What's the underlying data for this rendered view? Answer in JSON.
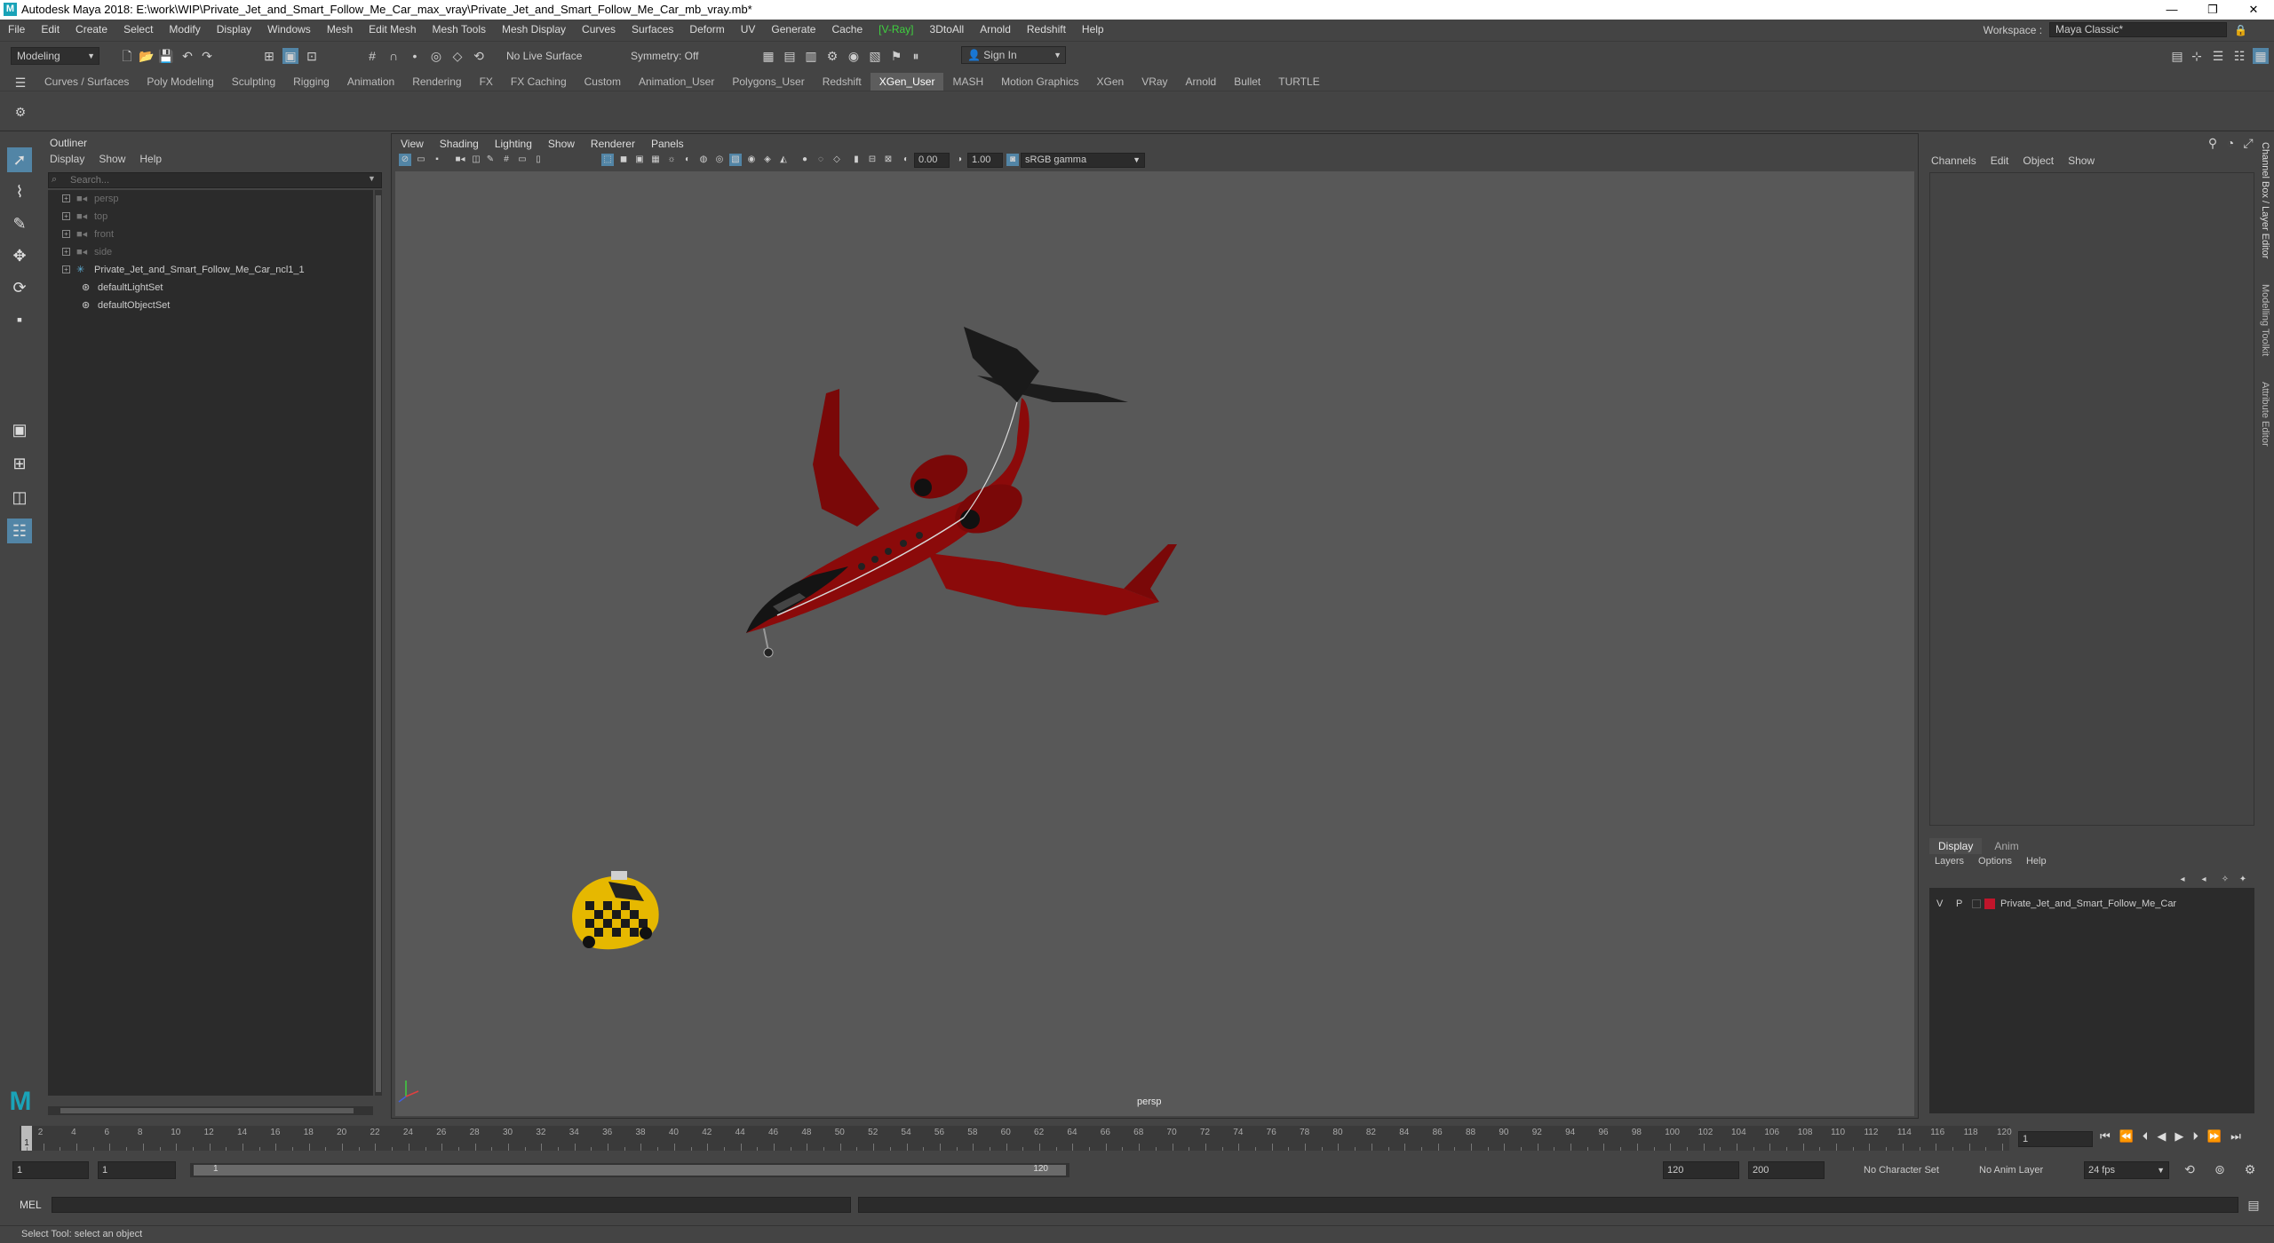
{
  "window": {
    "title": "Autodesk Maya 2018: E:\\work\\WIP\\Private_Jet_and_Smart_Follow_Me_Car_max_vray\\Private_Jet_and_Smart_Follow_Me_Car_mb_vray.mb*",
    "app_icon": "M",
    "minimize": "—",
    "maximize": "❐",
    "close": "✕"
  },
  "menubar": {
    "items": [
      "File",
      "Edit",
      "Create",
      "Select",
      "Modify",
      "Display",
      "Windows",
      "Mesh",
      "Edit Mesh",
      "Mesh Tools",
      "Mesh Display",
      "Curves",
      "Surfaces",
      "Deform",
      "UV",
      "Generate",
      "Cache",
      "[V-Ray]",
      "3DtoAll",
      "Arnold",
      "Redshift",
      "Help"
    ],
    "workspace_label": "Workspace :",
    "workspace_value": "Maya Classic*"
  },
  "statusline": {
    "menuset": "Modeling",
    "live_surface": "No Live Surface",
    "symmetry": "Symmetry: Off",
    "sign_in": "Sign In"
  },
  "shelf": {
    "tabs": [
      "Curves / Surfaces",
      "Poly Modeling",
      "Sculpting",
      "Rigging",
      "Animation",
      "Rendering",
      "FX",
      "FX Caching",
      "Custom",
      "Animation_User",
      "Polygons_User",
      "Redshift",
      "XGen_User",
      "MASH",
      "Motion Graphics",
      "XGen",
      "VRay",
      "Arnold",
      "Bullet",
      "TURTLE"
    ],
    "active_tab": "XGen_User"
  },
  "outliner": {
    "title": "Outliner",
    "menu": [
      "Display",
      "Show",
      "Help"
    ],
    "search_placeholder": "Search...",
    "items": [
      {
        "label": "persp",
        "dim": true,
        "icon": "camera-icon"
      },
      {
        "label": "top",
        "dim": true,
        "icon": "camera-icon"
      },
      {
        "label": "front",
        "dim": true,
        "icon": "camera-icon"
      },
      {
        "label": "side",
        "dim": true,
        "icon": "camera-icon"
      },
      {
        "label": "Private_Jet_and_Smart_Follow_Me_Car_ncl1_1",
        "dim": false,
        "icon": "group-icon"
      },
      {
        "label": "defaultLightSet",
        "dim": false,
        "icon": "set-icon"
      },
      {
        "label": "defaultObjectSet",
        "dim": false,
        "icon": "set-icon"
      }
    ]
  },
  "viewport": {
    "menu": [
      "View",
      "Shading",
      "Lighting",
      "Show",
      "Renderer",
      "Panels"
    ],
    "exposure": "0.00",
    "gamma": "1.00",
    "colorspace": "sRGB gamma",
    "camera": "persp"
  },
  "channelbox": {
    "menu": [
      "Channels",
      "Edit",
      "Object",
      "Show"
    ]
  },
  "layers": {
    "tabs": [
      "Display",
      "Anim"
    ],
    "menu": [
      "Layers",
      "Options",
      "Help"
    ],
    "rows": [
      {
        "v": "V",
        "p": "P",
        "name": "Private_Jet_and_Smart_Follow_Me_Car",
        "color": "#c0152b"
      }
    ]
  },
  "sidetabs": [
    "Channel Box / Layer Editor",
    "Modelling Toolkit",
    "Attribute Editor"
  ],
  "timeslider": {
    "ticks": [
      1,
      2,
      4,
      6,
      8,
      10,
      12,
      14,
      16,
      18,
      20,
      22,
      24,
      26,
      28,
      30,
      32,
      34,
      36,
      38,
      40,
      42,
      44,
      46,
      48,
      50,
      52,
      54,
      56,
      58,
      60,
      62,
      64,
      66,
      68,
      70,
      72,
      74,
      76,
      78,
      80,
      82,
      84,
      86,
      88,
      90,
      92,
      94,
      96,
      98,
      100,
      102,
      104,
      106,
      108,
      110,
      112,
      114,
      116,
      118,
      120
    ],
    "current_frame": "1",
    "current_frame_field": "1"
  },
  "rangeslider": {
    "start": "1",
    "start_inner": "1",
    "range_start": "1",
    "range_end": "120",
    "end_inner": "120",
    "end": "200",
    "character_set": "No Character Set",
    "anim_layer": "No Anim Layer",
    "fps": "24 fps"
  },
  "cmdline": {
    "language": "MEL"
  },
  "helpline": {
    "text": "Select Tool: select an object"
  },
  "colors": {
    "accent": "#5285a6",
    "jet_body": "#8b0a0a",
    "car_yellow": "#e6b800",
    "maya_teal": "#1aa3b8"
  }
}
